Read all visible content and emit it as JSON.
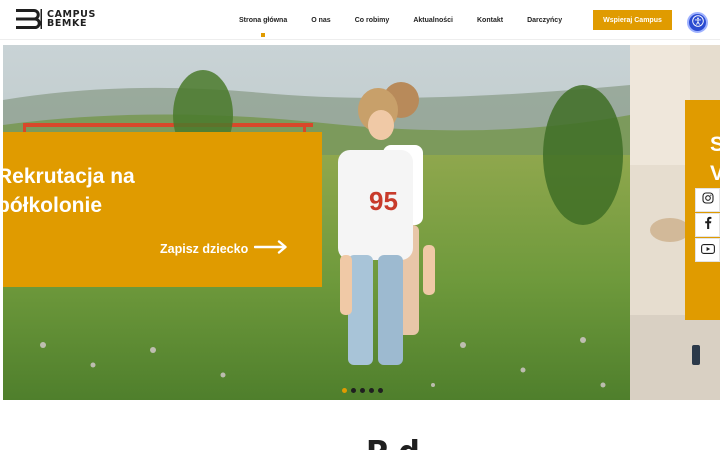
{
  "brand": {
    "line1": "CAMPUS",
    "line2": "BEMKE",
    "icon": "logo-b-mark",
    "accent_color": "#e09b00"
  },
  "nav": {
    "items": [
      {
        "label": "Strona główna",
        "active": true
      },
      {
        "label": "O nas"
      },
      {
        "label": "Co robimy"
      },
      {
        "label": "Aktualności"
      },
      {
        "label": "Kontakt"
      },
      {
        "label": "Darczyńcy"
      }
    ]
  },
  "header": {
    "support_label": "Wspieraj Campus",
    "accessibility_icon": "accessibility-icon",
    "accessibility_color": "#2a4bd1"
  },
  "hero": {
    "title_line1": "Rekrutacja na",
    "title_line2": "półkolonie",
    "cta_label": "Zapisz dziecko",
    "cta_icon": "arrow-right-icon",
    "slide_count": 5,
    "active_slide": 1
  },
  "next_slide": {
    "title_line1": "S",
    "title_line2": "V"
  },
  "social": {
    "items": [
      "instagram-icon",
      "facebook-icon",
      "youtube-icon"
    ]
  },
  "section": {
    "heading_fragment": "P   d"
  }
}
